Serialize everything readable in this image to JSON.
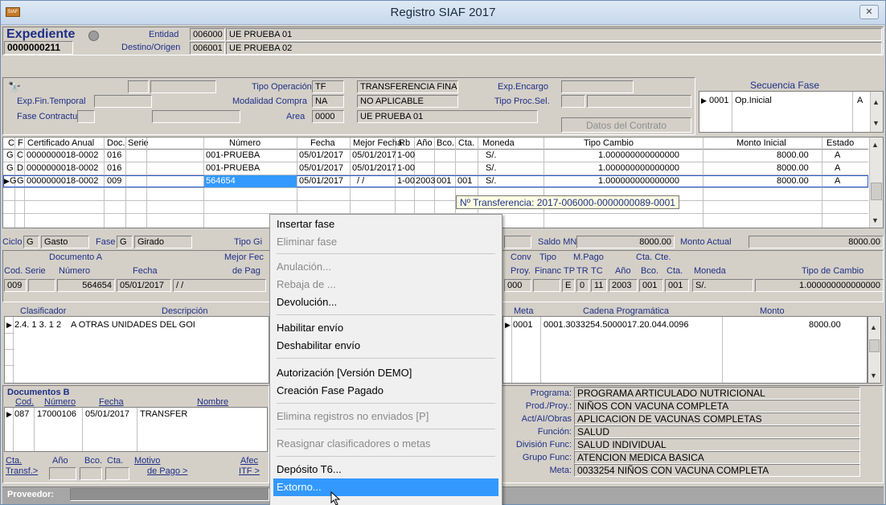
{
  "window": {
    "title": "Registro SIAF 2017",
    "app_icon_text": "SIAF",
    "close_glyph": "✕"
  },
  "expediente": {
    "label": "Expediente",
    "number": "0000000211",
    "entidad_label": "Entidad",
    "entidad_code": "006000",
    "entidad_name": "UE PRUEBA 01",
    "destino_label": "Destino/Origen",
    "destino_code": "006001",
    "destino_name": "UE PRUEBA 02"
  },
  "top": {
    "tipo_operacion_label": "Tipo Operación",
    "tipo_operacion_code": "TF",
    "tipo_operacion_name": "TRANSFERENCIA FINA",
    "exp_encargo_label": "Exp.Encargo",
    "exp_fin_label": "Exp.Fin.Temporal",
    "modalidad_label": "Modalidad Compra",
    "modalidad_code": "NA",
    "modalidad_name": "NO APLICABLE",
    "tipo_proc_label": "Tipo Proc.Sel.",
    "fase_contractual_label": "Fase Contractual",
    "area_label": "Area",
    "area_code": "0000",
    "area_name": "UE PRUEBA 01",
    "datos_contrato_label": "Datos del Contrato"
  },
  "secuencia": {
    "title": "Secuencia Fase",
    "row": {
      "code": "0001",
      "name": "Op.Inicial",
      "estado": "A"
    }
  },
  "fases_grid": {
    "headers": [
      "C",
      "F",
      "Certificado Anual",
      "Doc.",
      "Serie",
      "Número",
      "Fecha",
      "Mejor Fecha",
      "Rb",
      "Año",
      "Bco.",
      "Cta.",
      "Moneda",
      "Tipo Cambio",
      "Monto Inicial",
      "Estado"
    ],
    "rows": [
      {
        "c": "G",
        "f": "C",
        "cert": "0000000018-0002",
        "doc": "016",
        "num": "001-PRUEBA",
        "fecha": "05/01/2017",
        "mejor": "05/01/2017",
        "rb": "1-00",
        "anio": "",
        "bco": "",
        "cta": "",
        "moneda": "S/.",
        "tc": "1.000000000000000",
        "monto": "8000.00",
        "estado": "A"
      },
      {
        "c": "G",
        "f": "D",
        "cert": "0000000018-0002",
        "doc": "016",
        "num": "001-PRUEBA",
        "fecha": "05/01/2017",
        "mejor": "05/01/2017",
        "rb": "1-00",
        "anio": "",
        "bco": "",
        "cta": "",
        "moneda": "S/.",
        "tc": "1.000000000000000",
        "monto": "8000.00",
        "estado": "A"
      },
      {
        "c": "G",
        "f": "G",
        "cert": "0000000018-0002",
        "doc": "009",
        "num": "564654",
        "fecha": "05/01/2017",
        "mejor": "/ /",
        "rb": "1-00",
        "anio": "2003",
        "bco": "001",
        "cta": "001",
        "moneda": "S/.",
        "tc": "1.000000000000000",
        "monto": "8000.00",
        "estado": "A"
      }
    ]
  },
  "tooltip": "Nº Transferencia: 2017-006000-0000000089-0001",
  "ciclo": {
    "ciclo_label": "Ciclo",
    "ciclo_code": "G",
    "ciclo_name": "Gasto",
    "fase_label": "Fase",
    "fase_code": "G",
    "fase_name": "Girado",
    "tipo_label": "Tipo Gi",
    "saldo_label": "Saldo MN",
    "saldo_value": "8000.00",
    "monto_actual_label": "Monto Actual",
    "monto_actual_value": "8000.00"
  },
  "docA": {
    "title": "Documento A",
    "cod_label": "Cod.",
    "serie_label": "Serie",
    "numero_label": "Número",
    "fecha_label": "Fecha",
    "mejor_label_1": "Mejor Fec",
    "mejor_label_2": "de Pag",
    "cod": "009",
    "numero": "564654",
    "fecha": "05/01/2017",
    "mejor": "/ /",
    "conv_label_1": "Conv",
    "conv_label_2": "Proy.",
    "conv_value": "000",
    "tipo_label_1": "Tipo",
    "tipo_label_2": "Financ",
    "mpago_label": "M.Pago",
    "tp_label": "TP",
    "tr_label": "TR",
    "tc_label": "TC",
    "tp": "E",
    "tr": "0",
    "tc": "11",
    "ctacte_label": "Cta. Cte.",
    "anio_label": "Año",
    "bco_label": "Bco.",
    "cta_label": "Cta.",
    "anio": "2003",
    "bco": "001",
    "cta": "001",
    "moneda_label": "Moneda",
    "moneda": "S/.",
    "tipo_cambio_label": "Tipo de Cambio",
    "tipo_cambio": "1.000000000000000"
  },
  "clasif": {
    "clasificador_label": "Clasificador",
    "descripcion_label": "Descripción",
    "clasificador": "2.4. 1 3. 1 2",
    "descripcion": "A OTRAS UNIDADES DEL GOI",
    "meta_label": "Meta",
    "cadena_label": "Cadena Programática",
    "monto_label": "Monto",
    "meta": "0001",
    "cadena": "0001.3033254.5000017.20.044.0096",
    "monto": "8000.00"
  },
  "docB": {
    "title": "Documentos B",
    "cod_label": "Cod.",
    "numero_label": "Número",
    "fecha_label": "Fecha",
    "nombre_label": "Nombre",
    "cod": "087",
    "numero": "17000106",
    "fecha": "05/01/2017",
    "nombre": "TRANSFER",
    "cta_label_1": "Cta.",
    "cta_label_2": "Transf.>",
    "anio_label": "Año",
    "bco_label": "Bco.",
    "cta_label": "Cta.",
    "motivo_label_1": "Motivo",
    "motivo_label_2": "de Pago >",
    "afec_label_1": "Afec",
    "afec_label_2": "ITF >"
  },
  "programa": {
    "labels": [
      "Programa:",
      "Prod./Proy.:",
      "Act/AI/Obras",
      "Función:",
      "División Func:",
      "Grupo Func:",
      "Meta:"
    ],
    "values": [
      "PROGRAMA ARTICULADO NUTRICIONAL",
      "NIÑOS CON VACUNA COMPLETA",
      "APLICACION DE VACUNAS COMPLETAS",
      "SALUD",
      "SALUD INDIVIDUAL",
      "ATENCION MEDICA BASICA",
      "0033254  NIÑOS CON VACUNA COMPLETA"
    ]
  },
  "proveedor_label": "Proveedor:",
  "context_menu": {
    "items": [
      "Insertar fase",
      "Eliminar fase",
      "Anulación...",
      "Rebaja de ...",
      "Devolución...",
      "Habilitar envío",
      "Deshabilitar envío",
      "Autorización [Versión DEMO]",
      "Creación Fase Pagado",
      "Elimina registros no enviados [P]",
      "Reasignar clasificadores o metas",
      "Depósito T6...",
      "Extorno..."
    ]
  }
}
